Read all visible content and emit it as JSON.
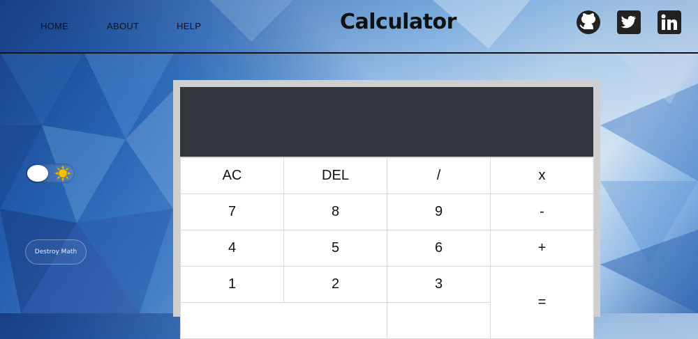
{
  "nav": {
    "items": [
      "HOME",
      "ABOUT",
      "HELP"
    ]
  },
  "title": "Calculator",
  "social": {
    "icons": [
      "github-icon",
      "twitter-icon",
      "linkedin-icon"
    ]
  },
  "theme_toggle": {
    "state": "off",
    "icon": "sun-icon"
  },
  "destroy_button": {
    "label": "Destroy Math"
  },
  "display": {
    "value": ""
  },
  "keys": {
    "ac": "AC",
    "del": "DEL",
    "divide": "/",
    "multiply": "x",
    "seven": "7",
    "eight": "8",
    "nine": "9",
    "minus": "-",
    "four": "4",
    "five": "5",
    "six": "6",
    "plus": "+",
    "one": "1",
    "two": "2",
    "three": "3",
    "equals": "="
  },
  "colors": {
    "display_bg": "#33373d",
    "frame": "#cfcfcf",
    "sun": "#f2c200"
  }
}
